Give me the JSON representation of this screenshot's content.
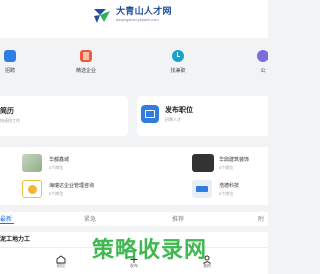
{
  "header": {
    "logo_title": "大青山人才网",
    "logo_sub": "daqingshan.yejiaoli.com",
    "brand_color": "#1f4f9c"
  },
  "categories": [
    {
      "label": "招聘",
      "icon": "briefcase-icon",
      "color": "#2f7de1"
    },
    {
      "label": "精选企业",
      "icon": "building-icon",
      "color": "#ee5a3c"
    },
    {
      "label": "找兼职",
      "icon": "clock-icon",
      "color": "#1aa3c9"
    },
    {
      "label": "公",
      "icon": "person-icon",
      "color": "#7d6be0"
    }
  ],
  "cards": {
    "resume": {
      "title": "简历",
      "subtitle": "快速找工作"
    },
    "post_job": {
      "title": "发布职位",
      "subtitle": "招聘人才"
    }
  },
  "companies": [
    {
      "name": "华都鑫城",
      "positions": "0个岗位"
    },
    {
      "name": "华鼎建筑装饰",
      "positions": "0个岗位"
    },
    {
      "name": "海瑞达企业管理咨询",
      "positions": "0个岗位"
    },
    {
      "name": "浩德科技",
      "positions": "0个岗位"
    }
  ],
  "tabs": [
    "最新",
    "紧急",
    "推荐",
    "附"
  ],
  "job": {
    "title": "泥工地力工"
  },
  "bottom_nav": [
    {
      "label": "职位",
      "icon": "home-icon"
    },
    {
      "label": "发布",
      "icon": "plus-icon"
    },
    {
      "label": "我的",
      "icon": "user-icon"
    }
  ],
  "watermark": "策略收录网"
}
